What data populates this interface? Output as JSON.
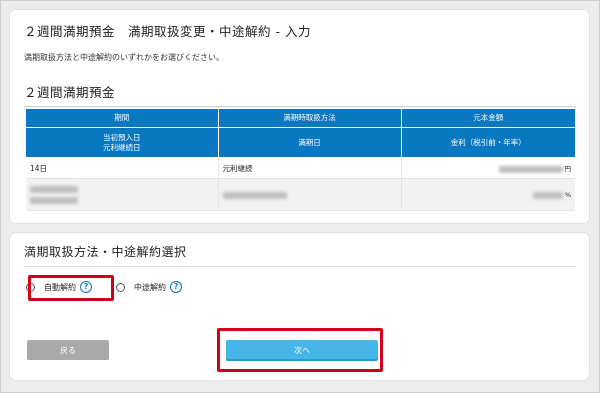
{
  "page": {
    "title": "２週間満期預金　満期取扱変更・中途解約 - 入力",
    "lead": "満期取扱方法と中途解約のいずれかをお選びください。"
  },
  "deposit": {
    "heading": "２週間満期預金",
    "headers_row1": [
      "期間",
      "満期時取扱方法",
      "元本金額"
    ],
    "headers_row2": [
      "当初預入日\n元利継続日",
      "満期日",
      "金利（税引前・年率）"
    ],
    "row1": {
      "period": "14日",
      "method": "元利継続",
      "amount_unit": "円"
    },
    "row2": {
      "rate_unit": "%"
    }
  },
  "selection": {
    "heading": "満期取扱方法・中途解約選択",
    "options": [
      {
        "label": "自動解約",
        "help_icon": "question-circle-icon"
      },
      {
        "label": "中途解約",
        "help_icon": "question-circle-icon"
      }
    ],
    "help_glyph": "?"
  },
  "buttons": {
    "back": "戻る",
    "next": "次へ"
  },
  "colors": {
    "header_blue": "#0a77c1",
    "next_button": "#45b6e7",
    "highlight": "#d0021b",
    "back_button": "#a9a9a9"
  }
}
